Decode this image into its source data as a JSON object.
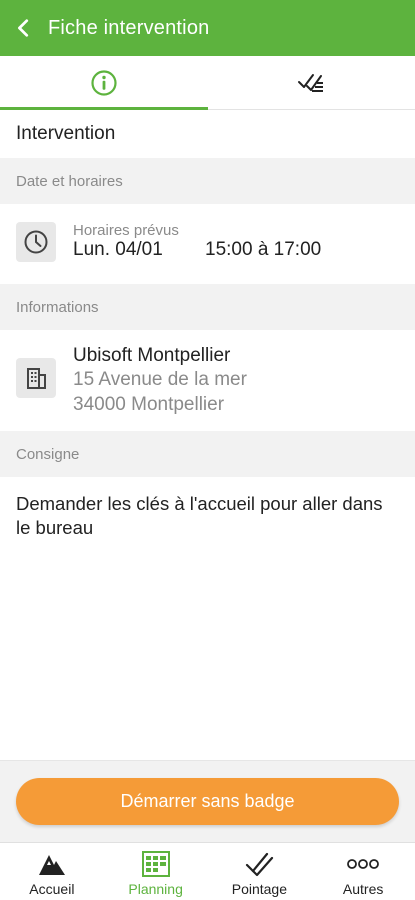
{
  "header": {
    "title": "Fiche intervention",
    "back_icon": "chevron-left-icon"
  },
  "tabs": [
    {
      "icon": "info-icon",
      "active": true
    },
    {
      "icon": "checklist-icon",
      "active": false
    }
  ],
  "intervention_title": "Intervention",
  "sections": {
    "schedule": {
      "header": "Date et horaires",
      "icon": "clock-icon",
      "caption": "Horaires prévus",
      "date": "Lun. 04/01",
      "hours": "15:00 à 17:00"
    },
    "info": {
      "header": "Informations",
      "icon": "building-icon",
      "name": "Ubisoft Montpellier",
      "address_line1": "15 Avenue de la mer",
      "address_line2": "34000 Montpellier"
    },
    "consigne": {
      "header": "Consigne",
      "text": "Demander les clés à l'accueil pour aller dans le bureau"
    }
  },
  "action": {
    "label": "Démarrer sans badge"
  },
  "tabbar": [
    {
      "label": "Accueil",
      "icon": "mountain-logo-icon",
      "active": false
    },
    {
      "label": "Planning",
      "icon": "calendar-grid-icon",
      "active": true
    },
    {
      "label": "Pointage",
      "icon": "check-stamp-icon",
      "active": false
    },
    {
      "label": "Autres",
      "icon": "more-dots-icon",
      "active": false
    }
  ],
  "colors": {
    "primary": "#5db33e",
    "accent": "#f59b37",
    "section_bg": "#f2f2f2",
    "muted_text": "#8a8a8a"
  }
}
